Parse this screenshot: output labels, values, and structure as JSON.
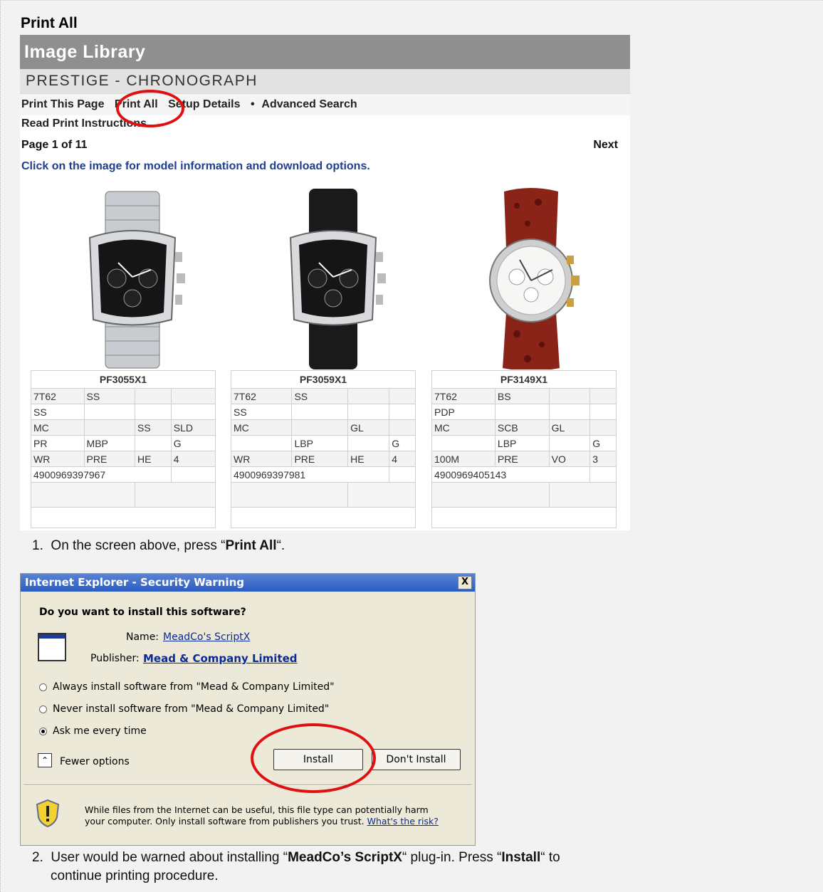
{
  "section_title": "Print All",
  "library": {
    "title": "Image Library",
    "collection": "PRESTIGE - CHRONOGRAPH",
    "nav": [
      "Print This Page",
      "Print All",
      "Setup Details",
      "•",
      "Advanced Search"
    ],
    "read_instructions": "Read Print Instructions",
    "page_label": "Page 1 of 11",
    "next_label": "Next",
    "click_message": "Click on the image for model information and download options.",
    "products": [
      {
        "model": "PF3055X1",
        "rows": [
          [
            "7T62",
            "SS",
            "",
            ""
          ],
          [
            "SS",
            "",
            "",
            ""
          ],
          [
            "MC",
            "",
            "SS",
            "SLD"
          ],
          [
            "PR",
            "MBP",
            "",
            "G"
          ],
          [
            "WR",
            "PRE",
            "HE",
            "4"
          ],
          [
            "4900969397967",
            "",
            "",
            ""
          ]
        ]
      },
      {
        "model": "PF3059X1",
        "rows": [
          [
            "7T62",
            "SS",
            "",
            ""
          ],
          [
            "SS",
            "",
            "",
            ""
          ],
          [
            "MC",
            "",
            "GL",
            ""
          ],
          [
            "",
            "LBP",
            "",
            "G"
          ],
          [
            "WR",
            "PRE",
            "HE",
            "4"
          ],
          [
            "4900969397981",
            "",
            "",
            ""
          ]
        ]
      },
      {
        "model": "PF3149X1",
        "rows": [
          [
            "7T62",
            "BS",
            "",
            ""
          ],
          [
            "PDP",
            "",
            "",
            ""
          ],
          [
            "MC",
            "SCB",
            "GL",
            ""
          ],
          [
            "",
            "LBP",
            "",
            "G"
          ],
          [
            "100M",
            "PRE",
            "VO",
            "3"
          ],
          [
            "4900969405143",
            "",
            "",
            ""
          ]
        ]
      }
    ]
  },
  "step1": {
    "number": "1.",
    "pre": "On the screen above, press “",
    "bold": "Print All",
    "post": "“."
  },
  "dialog": {
    "title": "Internet Explorer - Security Warning",
    "close": "X",
    "question": "Do you want to install this software?",
    "name_label": "Name:",
    "name_value": "MeadCo's ScriptX",
    "publisher_label": "Publisher:",
    "publisher_value": "Mead & Company Limited",
    "options": [
      "Always install software from \"Mead & Company Limited\"",
      "Never install software from \"Mead & Company Limited\"",
      "Ask me every time"
    ],
    "selected_option": 2,
    "fewer_label": "Fewer options",
    "install_label": "Install",
    "dont_install_label": "Don't Install",
    "warning_line1": "While files from the Internet can be useful, this file type can potentially harm",
    "warning_line2": "your computer. Only install software from publishers you trust.",
    "risk_link": "What's the risk?"
  },
  "step2": {
    "number": "2.",
    "pre": "User would be warned about installing “",
    "bold1": "MeadCo’s ScriptX",
    "mid": "“ plug-in. Press “",
    "bold2": "Install",
    "post": "“ to",
    "line2": "continue printing procedure."
  }
}
